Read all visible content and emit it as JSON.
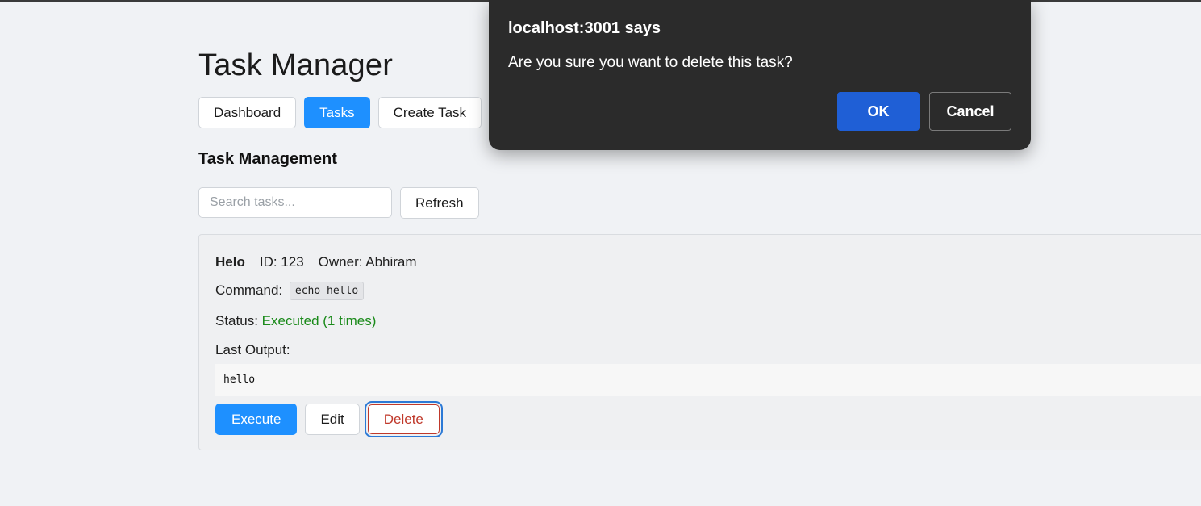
{
  "app": {
    "title": "Task Manager"
  },
  "nav": {
    "items": [
      {
        "label": "Dashboard",
        "active": false
      },
      {
        "label": "Tasks",
        "active": true
      },
      {
        "label": "Create Task",
        "active": false
      }
    ]
  },
  "section": {
    "title": "Task Management"
  },
  "search": {
    "placeholder": "Search tasks...",
    "value": "",
    "refresh_label": "Refresh"
  },
  "task": {
    "name": "Helo",
    "id_text": "ID: 123",
    "owner_text": "Owner: Abhiram",
    "command_label": "Command:",
    "command": "echo hello",
    "status_label": "Status:",
    "status_value": "Executed (1 times)",
    "status_color": "#1a8a1a",
    "output_label": "Last Output:",
    "output": "hello",
    "actions": {
      "execute_label": "Execute",
      "edit_label": "Edit",
      "delete_label": "Delete"
    }
  },
  "dialog": {
    "title": "localhost:3001 says",
    "message": "Are you sure you want to delete this task?",
    "ok_label": "OK",
    "cancel_label": "Cancel"
  },
  "colors": {
    "primary": "#1e90ff",
    "danger": "#c0392b",
    "dialog_bg": "#2b2b2b",
    "dialog_ok": "#1f5fd6"
  }
}
